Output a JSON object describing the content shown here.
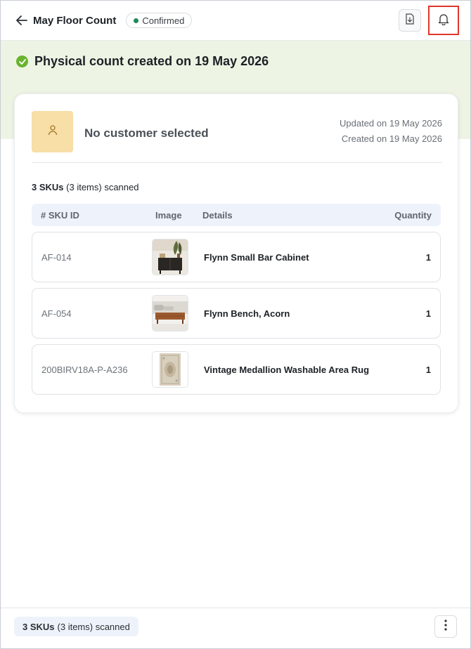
{
  "header": {
    "title": "May Floor Count",
    "status_badge": "Confirmed",
    "icons": {
      "back": "arrow-left-icon",
      "download": "download-icon",
      "notifications": "bell-icon"
    }
  },
  "status": {
    "message": "Physical count created on 19 May 2026",
    "icon": "check-circle-icon"
  },
  "customer": {
    "label": "No customer selected",
    "updated": "Updated on 19 May 2026",
    "created": "Created on 19 May 2026",
    "avatar_icon": "user-icon"
  },
  "summary": {
    "count": "3 SKUs",
    "detail": "(3 items) scanned"
  },
  "table": {
    "headers": [
      "# SKU ID",
      "Image",
      "Details",
      "Quantity"
    ],
    "rows": [
      {
        "sku": "AF-014",
        "details": "Flynn Small Bar Cabinet",
        "qty": "1",
        "image": "bar-cabinet"
      },
      {
        "sku": "AF-054",
        "details": "Flynn Bench, Acorn",
        "qty": "1",
        "image": "bench"
      },
      {
        "sku": "200BIRV18A-P-A236",
        "details": "Vintage Medallion Washable Area Rug",
        "qty": "1",
        "image": "rug"
      }
    ]
  },
  "footer": {
    "count": "3 SKUs",
    "detail": "(3 items) scanned",
    "menu_icon": "kebab-menu-icon"
  },
  "colors": {
    "accent_green": "#68b42f",
    "band": "#eef4e4",
    "confirmed_dot": "#1f8a57",
    "highlight_border": "#e0362b",
    "avatar_bg": "#f8dea7"
  }
}
